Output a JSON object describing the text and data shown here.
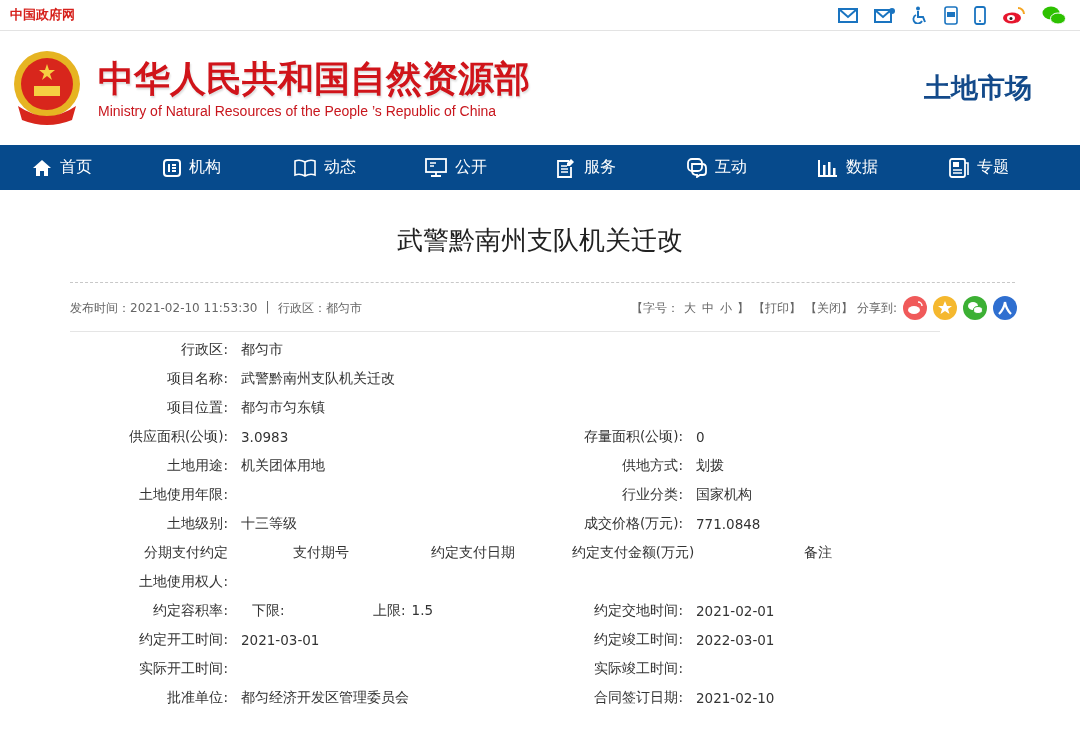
{
  "top_bar": {
    "site_link": "中国政府网",
    "icons": [
      {
        "kind": "mail"
      },
      {
        "kind": "mail-settings"
      },
      {
        "kind": "accessibility"
      },
      {
        "kind": "app"
      },
      {
        "kind": "mobile"
      },
      {
        "kind": "weibo"
      },
      {
        "kind": "wechat"
      }
    ]
  },
  "header": {
    "title": "中华人民共和国自然资源部",
    "subtitle": "Ministry of Natural Resources of the People ’s Republic of China",
    "section": "土地市场"
  },
  "nav": [
    {
      "label": "首页",
      "kind": "home"
    },
    {
      "label": "机构",
      "kind": "org"
    },
    {
      "label": "动态",
      "kind": "book"
    },
    {
      "label": "公开",
      "kind": "monitor"
    },
    {
      "label": "服务",
      "kind": "form"
    },
    {
      "label": "互动",
      "kind": "chat"
    },
    {
      "label": "数据",
      "kind": "chart"
    },
    {
      "label": "专题",
      "kind": "doc"
    }
  ],
  "article": {
    "title": "武警黔南州支队机关迁改",
    "published": "发布时间：2021-02-10 11:53:30",
    "separator": "|",
    "region": "行政区：都匀市",
    "tools": {
      "font_size_open": "【字号：",
      "sizes": [
        "大",
        "中",
        "小"
      ],
      "font_size_close": "】",
      "print": "【打印】",
      "close": "【关闭】",
      "share_label": "分享到:",
      "share": [
        {
          "kind": "weibo",
          "color": "#f05a5a"
        },
        {
          "kind": "qzone",
          "color": "#f5b82e"
        },
        {
          "kind": "wechat",
          "color": "#3cb034"
        },
        {
          "kind": "renren",
          "color": "#2f6fd0"
        }
      ]
    }
  },
  "details": [
    {
      "kind": "pair",
      "label": "行政区:",
      "value": "都匀市"
    },
    {
      "kind": "pair",
      "label": "项目名称:",
      "value": "武警黔南州支队机关迁改"
    },
    {
      "kind": "pair",
      "label": "项目位置:",
      "value": "都匀市匀东镇"
    },
    {
      "kind": "pair",
      "label": "供应面积(公顷):",
      "value": "3.0983",
      "label2": "存量面积(公顷):",
      "value2": "0"
    },
    {
      "kind": "pair",
      "label": "土地用途:",
      "value": "机关团体用地",
      "label2": "供地方式:",
      "value2": "划拨"
    },
    {
      "kind": "pair",
      "label": "土地使用年限:",
      "label2": "行业分类:",
      "value2": "国家机构"
    },
    {
      "kind": "pair",
      "label": "土地级别:",
      "value": "十三等级",
      "label2": "成交价格(万元):",
      "value2": "771.0848"
    },
    {
      "kind": "header",
      "cells": [
        "分期支付约定",
        "支付期号",
        "约定支付日期",
        "约定支付金额(万元)",
        "备注"
      ]
    },
    {
      "kind": "pair",
      "label": "土地使用权人:"
    },
    {
      "kind": "range",
      "label": "约定容积率:",
      "lower_label": "下限:",
      "upper_label": "上限:",
      "upper_value": "1.5",
      "label2": "约定交地时间:",
      "value2": "2021-02-01"
    },
    {
      "kind": "pair",
      "label": "约定开工时间:",
      "value": "2021-03-01",
      "label2": "约定竣工时间:",
      "value2": "2022-03-01"
    },
    {
      "kind": "pair",
      "label": "实际开工时间:",
      "label2": "实际竣工时间:"
    },
    {
      "kind": "pair",
      "label": "批准单位:",
      "value": "都匀经济开发区管理委员会",
      "label2": "合同签订日期:",
      "value2": "2021-02-10"
    }
  ]
}
